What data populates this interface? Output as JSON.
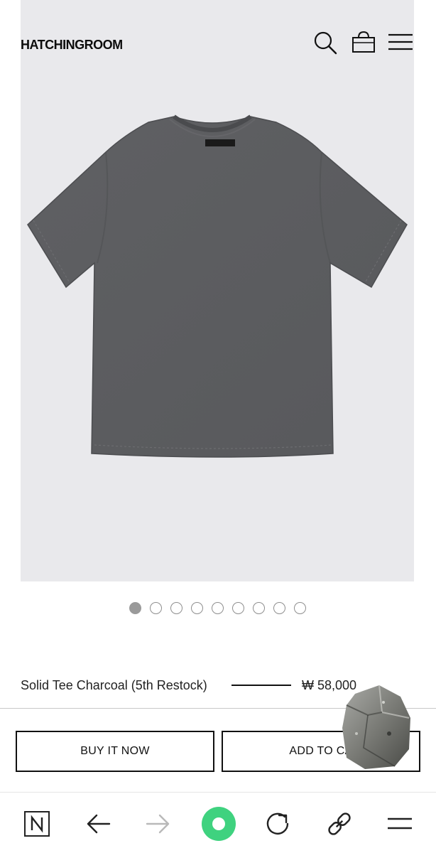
{
  "header": {
    "brand": "HATCHINGROOM",
    "icons": [
      "search-icon",
      "shopping-bag-icon",
      "hamburger-menu-icon"
    ]
  },
  "carousel": {
    "total_slides": 9,
    "active_index": 0
  },
  "product": {
    "title": "Solid Tee Charcoal (5th Restock)",
    "price": "₩ 58,000"
  },
  "actions": {
    "buy_now": "BUY IT NOW",
    "add_to_cart": "ADD TO CA"
  },
  "browser_bar": {
    "items": [
      "naver-n-icon",
      "back-arrow-icon",
      "forward-arrow-icon",
      "green-home-icon",
      "reload-icon",
      "link-icon",
      "menu-icon"
    ],
    "accent_color": "#3fd27f"
  },
  "colors": {
    "hero_background": "#e9e9ec",
    "shirt": "#5d5e61"
  }
}
